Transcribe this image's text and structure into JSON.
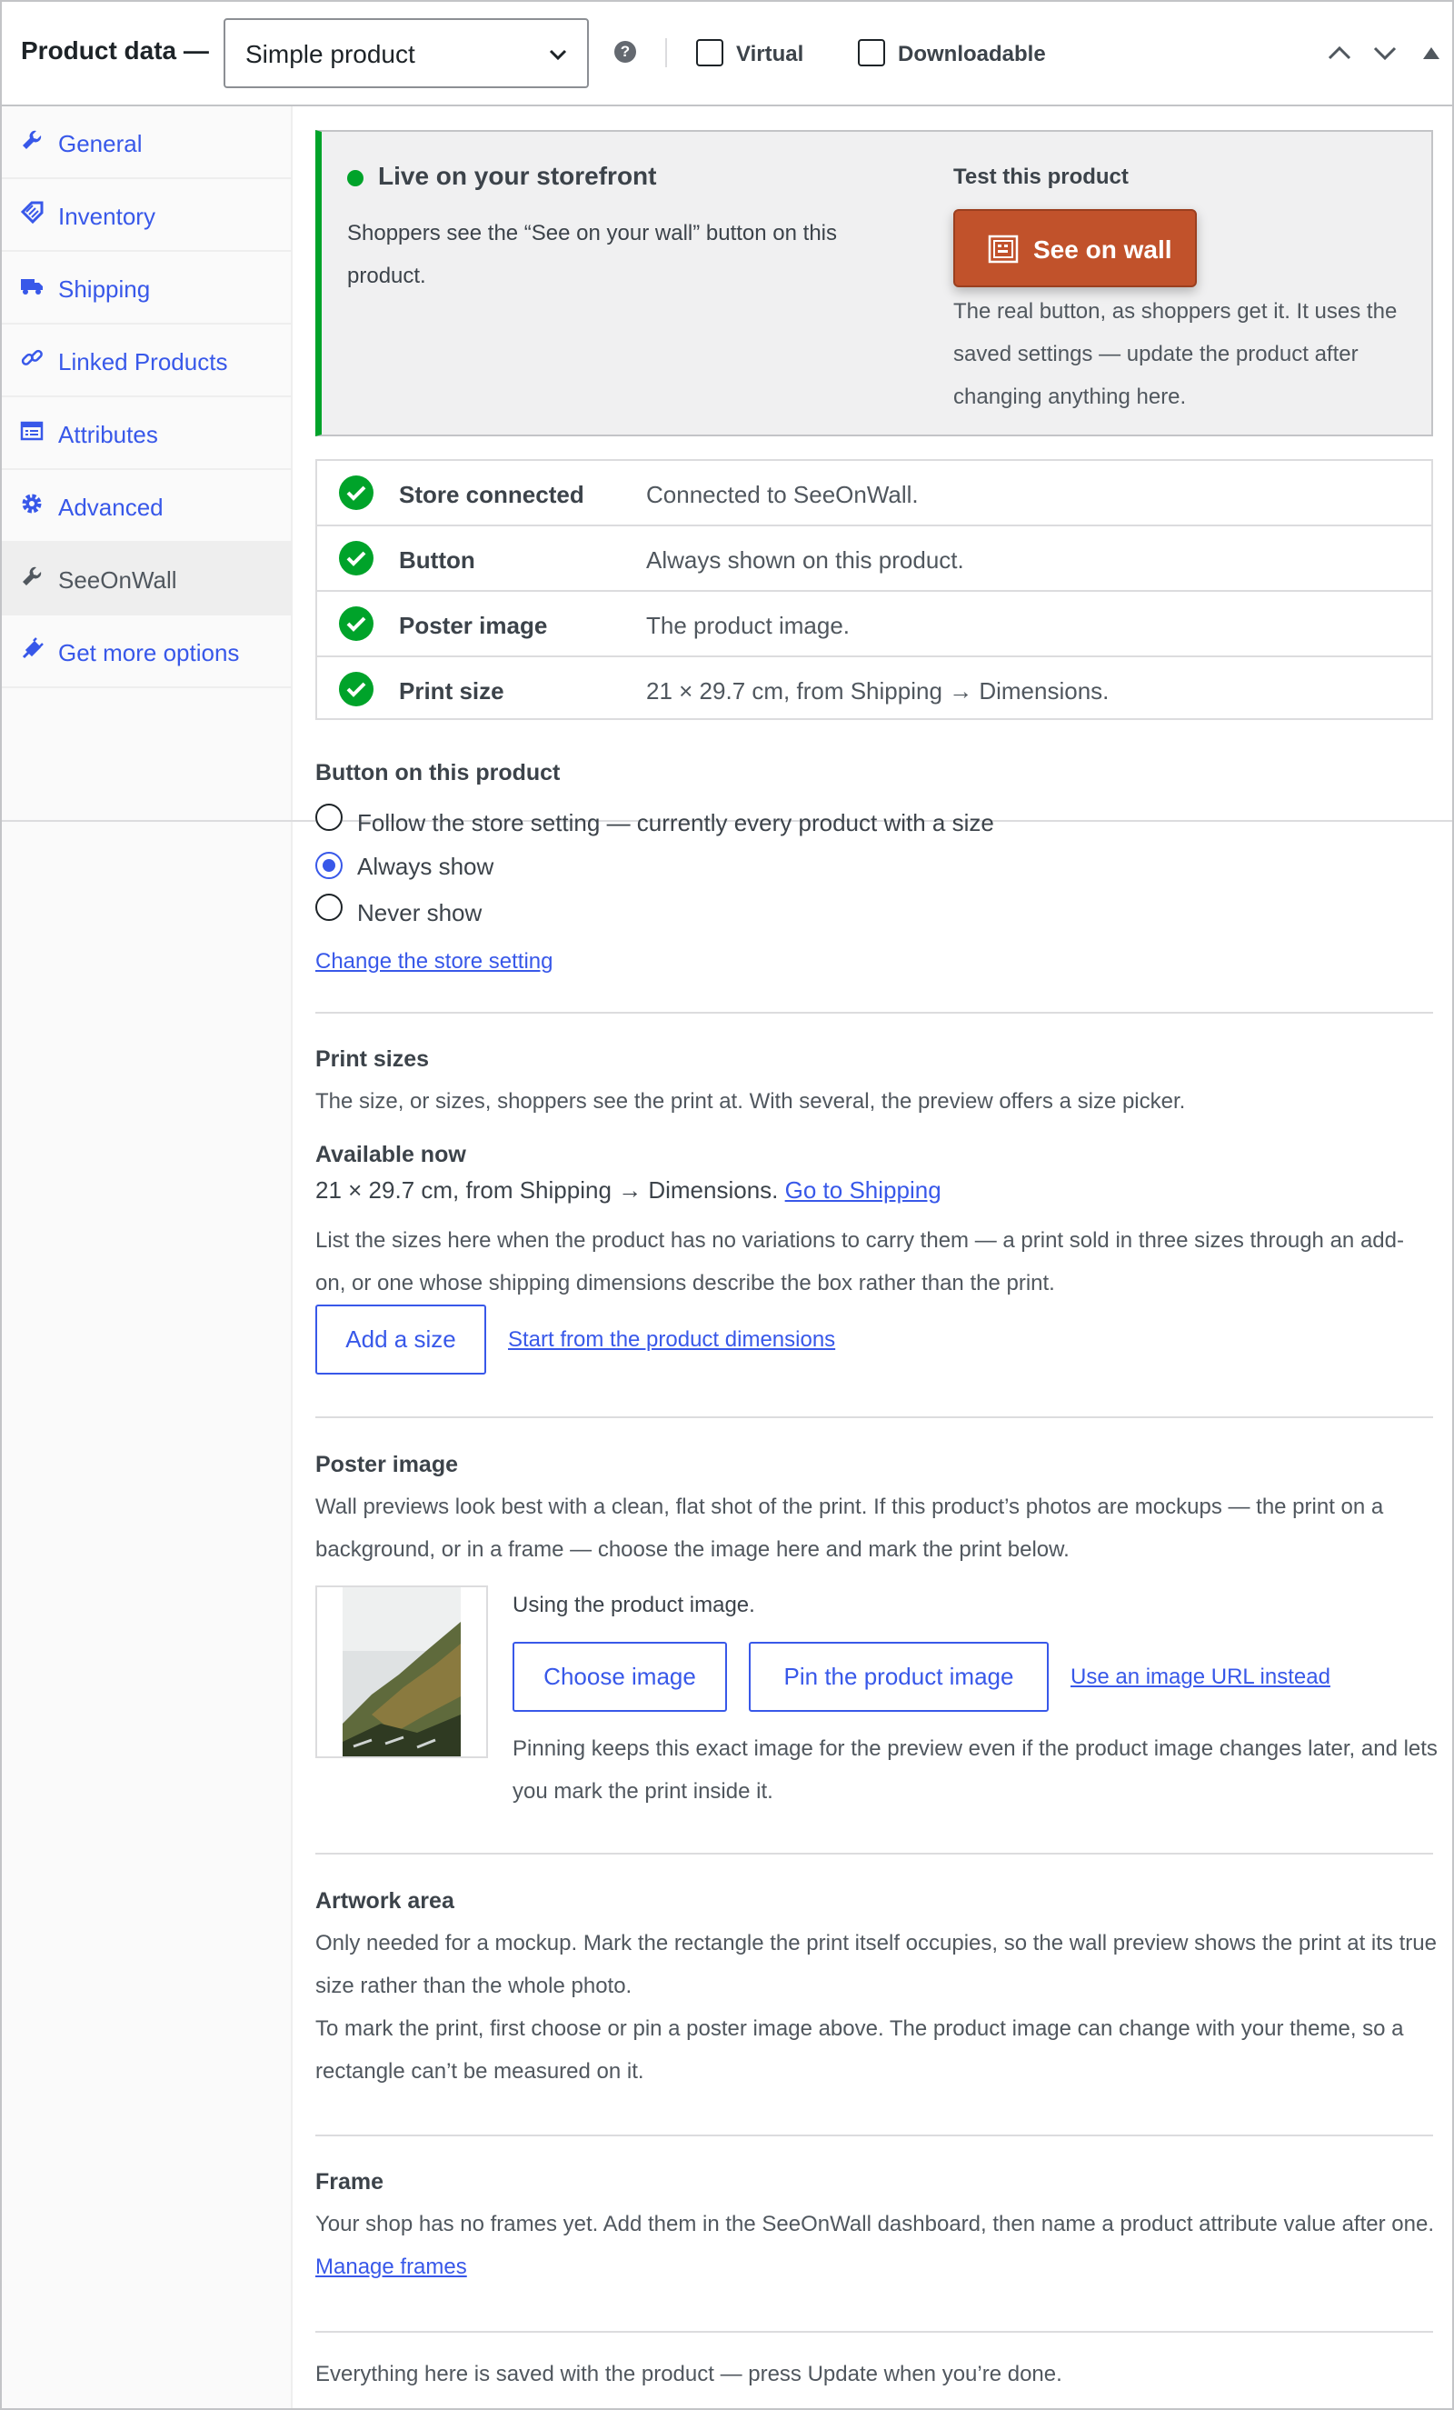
{
  "header": {
    "title": "Product data —",
    "product_type": "Simple product",
    "help": "?",
    "virtual_label": "Virtual",
    "downloadable_label": "Downloadable"
  },
  "nav": {
    "items": [
      {
        "label": "General",
        "icon": "wrench-icon"
      },
      {
        "label": "Inventory",
        "icon": "tag-icon"
      },
      {
        "label": "Shipping",
        "icon": "truck-icon"
      },
      {
        "label": "Linked Products",
        "icon": "link-icon"
      },
      {
        "label": "Attributes",
        "icon": "list-icon"
      },
      {
        "label": "Advanced",
        "icon": "gear-icon"
      },
      {
        "label": "SeeOnWall",
        "icon": "wrench-icon"
      },
      {
        "label": "Get more options",
        "icon": "plugin-icon"
      }
    ],
    "active": "SeeOnWall"
  },
  "live": {
    "title": "Live on your storefront",
    "desc": "Shoppers see the “See on your wall” button on this product.",
    "test_title": "Test this product",
    "button": "See on wall",
    "test_desc": "The real button, as shoppers get it. It uses the saved settings — update the product after changing anything here."
  },
  "status": [
    {
      "key": "Store connected",
      "value": "Connected to SeeOnWall."
    },
    {
      "key": "Button",
      "value": "Always shown on this product."
    },
    {
      "key": "Poster image",
      "value": "The product image."
    },
    {
      "key": "Print size",
      "value": "21 × 29.7 cm, from Shipping → Dimensions."
    }
  ],
  "button_section": {
    "title": "Button on this product",
    "options": [
      "Follow the store setting — currently every product with a size",
      "Always show",
      "Never show"
    ],
    "selected": "Always show",
    "change_link": "Change the store setting"
  },
  "print_sizes": {
    "title": "Print sizes",
    "desc": "The size, or sizes, shoppers see the print at. With several, the preview offers a size picker.",
    "available_title": "Available now",
    "available_value": "21 × 29.7 cm, from Shipping → Dimensions.",
    "go_link": "Go to Shipping",
    "note": "List the sizes here when the product has no variations to carry them — a print sold in three sizes through an add-on, or one whose shipping dimensions describe the box rather than the print.",
    "add_button": "Add a size",
    "start_link": "Start from the product dimensions"
  },
  "poster": {
    "title": "Poster image",
    "desc": "Wall previews look best with a clean, flat shot of the print. If this product’s photos are mockups — the print on a background, or in a frame — choose the image here and mark the print below.",
    "using": "Using the product image.",
    "choose_button": "Choose image",
    "pin_button": "Pin the product image",
    "url_link": "Use an image URL instead",
    "note": "Pinning keeps this exact image for the preview even if the product image changes later, and lets you mark the print inside it."
  },
  "artwork": {
    "title": "Artwork area",
    "desc1": "Only needed for a mockup. Mark the rectangle the print itself occupies, so the wall preview shows the print at its true size rather than the whole photo.",
    "desc2": "To mark the print, first choose or pin a poster image above. The product image can change with your theme, so a rectangle can’t be measured on it."
  },
  "frame": {
    "title": "Frame",
    "desc": "Your shop has no frames yet. Add them in the SeeOnWall dashboard, then name a product attribute value after one.",
    "manage_link": "Manage frames"
  },
  "footer": "Everything here is saved with the product — press Update when you’re done.",
  "colors": {
    "accent": "#3858e9",
    "success": "#00a32a",
    "button": "#c1522b"
  }
}
